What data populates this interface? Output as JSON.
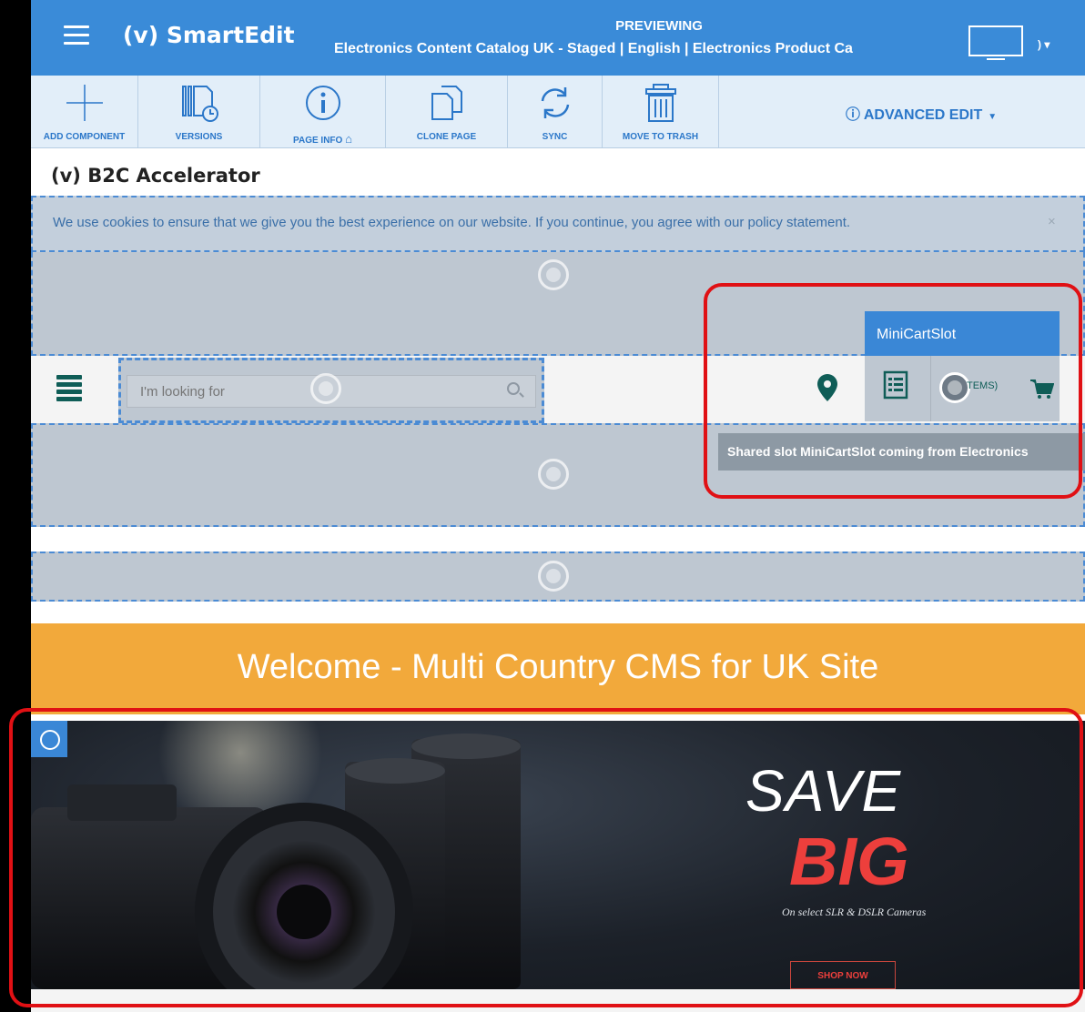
{
  "app": {
    "name": "SmartEdit",
    "previewing_label": "PREVIEWING",
    "previewing_value": "Electronics Content Catalog UK - Staged | English | Electronics Product Ca",
    "device_label": ")"
  },
  "toolbar": {
    "items": [
      {
        "label": "ADD COMPONENT",
        "icon": "plus-icon"
      },
      {
        "label": "VERSIONS",
        "icon": "versions-icon"
      },
      {
        "label": "PAGE INFO",
        "icon": "info-icon"
      },
      {
        "label": "CLONE PAGE",
        "icon": "clone-icon"
      },
      {
        "label": "SYNC",
        "icon": "sync-icon"
      },
      {
        "label": "MOVE TO TRASH",
        "icon": "trash-icon"
      }
    ],
    "advanced_edit": "ADVANCED EDIT"
  },
  "site": {
    "name": "B2C Accelerator",
    "cookie_notice": "We use cookies to ensure that we give you the best experience on our website. If you continue, you agree with our policy statement.",
    "cookie_close": "×",
    "search_placeholder": "I'm looking for",
    "minicart_items": "TEMS)",
    "minicart_slot_label": "MiniCartSlot",
    "shared_slot_tooltip": "Shared slot MiniCartSlot coming from Electronics",
    "welcome": "Welcome - Multi Country CMS for UK Site"
  },
  "banner": {
    "line1": "SAVE",
    "line2": "BIG",
    "subtitle": "On select SLR & DSLR Cameras",
    "cta": "SHOP NOW"
  },
  "colors": {
    "primary": "#3a8bd8",
    "toolbar_bg": "#e2eef9",
    "slot_bg": "#bec7d1",
    "slot_border": "#4b8bd4",
    "welcome_bg": "#f2a93b",
    "highlight": "#e01014",
    "banner_red": "#ed3f3c"
  }
}
